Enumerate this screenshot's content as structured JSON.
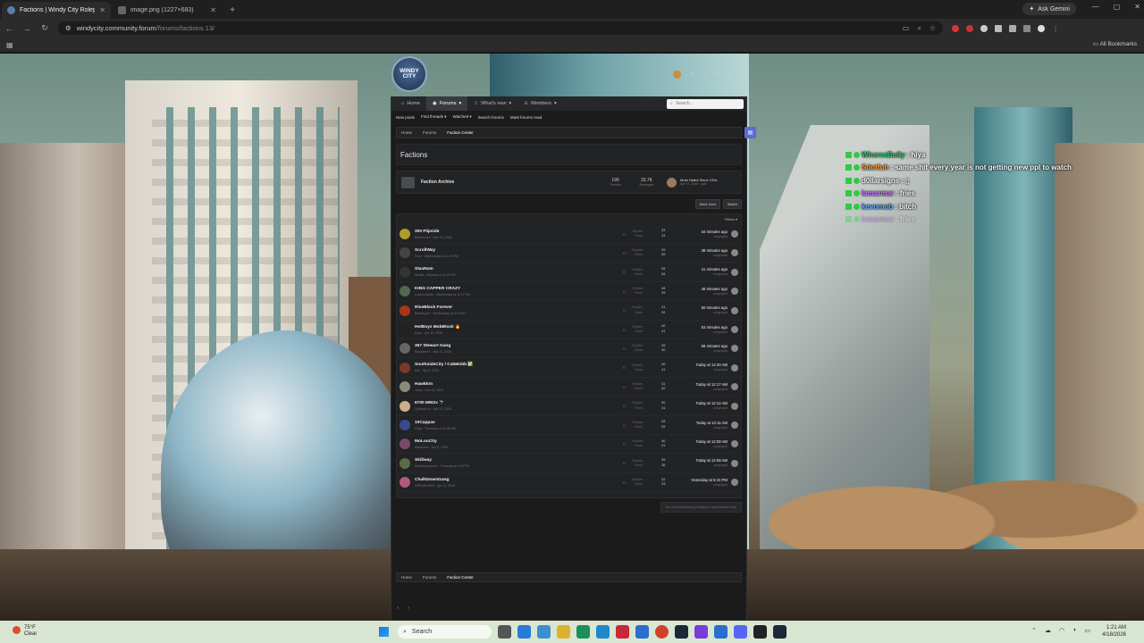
{
  "browser": {
    "tabs": [
      {
        "title": "Factions | Windy City Roleplay",
        "active": true
      },
      {
        "title": "image.png (1227×683)",
        "active": false
      }
    ],
    "new_tab_icon": "plus-icon",
    "ask_gemini": "Ask Gemini",
    "url_host": "windycity.community.forum",
    "url_path": "/forums/factions.13/",
    "all_bookmarks": "All Bookmarks"
  },
  "forum": {
    "logo_text": "WINDY CITY",
    "nav": {
      "home": "Home",
      "forums": "Forums",
      "whats_new": "What's new",
      "members": "Members",
      "search_placeholder": "Search..."
    },
    "subnav": [
      "New posts",
      "Find threads",
      "Watched",
      "Search forums",
      "Mark forums read"
    ],
    "breadcrumbs": [
      "Home",
      "Forums",
      "Faction Center"
    ],
    "page_title": "Factions",
    "archive": {
      "title": "Faction Archive",
      "threads": "199",
      "threads_label": "Threads",
      "messages": "33.7K",
      "messages_label": "Messages",
      "last_title": "Most Hated Since 100s",
      "last_meta": "Apr 17, 2026 · yaki"
    },
    "buttons": {
      "mark_read": "Mark read",
      "watch": "Watch",
      "filters": "Filters"
    },
    "threads": [
      {
        "title": "300 Flipside",
        "meta": "BlueDream · Nov 14, 2025",
        "replies": "33",
        "views": "34",
        "time": "34 minutes ago",
        "user": "unsyruped",
        "color": "#b09a2a"
      },
      {
        "title": "ScrollWay",
        "meta": "Drizz · Wednesday at 11:40 PM",
        "replies": "29",
        "views": "30",
        "time": "38 minutes ago",
        "user": "unsyruped",
        "color": "#444"
      },
      {
        "title": "StaxNom",
        "meta": "Medlin · Monday at 11:13 PM",
        "replies": "28",
        "views": "28",
        "time": "41 minutes ago",
        "user": "unsyruped",
        "color": "#333"
      },
      {
        "title": "KING CAPPER CRAZY",
        "meta": "poleto.cardity · Wednesday at 11:07 PM",
        "replies": "28",
        "views": "29",
        "time": "48 minutes ago",
        "user": "unsyruped",
        "color": "#556655"
      },
      {
        "title": "RiseBlock Forever",
        "meta": "Bleaveyork · Wednesday at 8:19 AM",
        "replies": "31",
        "views": "32",
        "time": "50 minutes ago",
        "user": "unsyruped",
        "color": "#a8361a"
      },
      {
        "title": "HotBoyz MobBlock 🔥",
        "meta": "Ryan · Apr 10, 2026",
        "replies": "40",
        "views": "41",
        "time": "53 minutes ago",
        "user": "unsyruped",
        "color": "#222"
      },
      {
        "title": "357 Stewart Gang",
        "meta": "Blackjerms · Mar 31, 2026",
        "replies": "39",
        "views": "40",
        "time": "58 minutes ago",
        "user": "unsyruped",
        "color": "#666"
      },
      {
        "title": "SouthsideCity / CabMobb ✅",
        "meta": "Bex · Apr 8, 2026",
        "replies": "40",
        "views": "41",
        "time": "Today at 12:20 AM",
        "user": "unsyruped",
        "color": "#7a3a2a"
      },
      {
        "title": "HawkEm",
        "meta": "Jrkay · Dec 11, 2025",
        "replies": "41",
        "views": "42",
        "time": "Today at 12:17 AM",
        "user": "unsyruped",
        "color": "#8a8a7a"
      },
      {
        "title": "6700 MW2x 🔭",
        "meta": "Quitbank.tv · Apr 12, 2026",
        "replies": "40",
        "views": "41",
        "time": "Today at 12:14 AM",
        "user": "unsyruped",
        "color": "#c9b08a"
      },
      {
        "title": "10Cappas",
        "meta": "Flakx · Thursday at 10:38 PM",
        "replies": "28",
        "views": "29",
        "time": "Today at 12:11 AM",
        "user": "unsyruped",
        "color": "#3a4a8a"
      },
      {
        "title": "MoLouCity",
        "meta": "Mavisiaho · Apr 9, 2026",
        "replies": "40",
        "views": "41",
        "time": "Today at 12:08 AM",
        "user": "unsyruped",
        "color": "#7a4a6a"
      },
      {
        "title": "Skillway",
        "meta": "thismeisauncure · Thursday at 9:38 PM",
        "replies": "35",
        "views": "36",
        "time": "Today at 12:08 AM",
        "user": "unsyruped",
        "color": "#5a6a4a"
      },
      {
        "title": "ChalkDownGang",
        "meta": "DREAM-OMG · Apr 11, 2026",
        "replies": "32",
        "views": "33",
        "time": "Yesterday at 5:24 PM",
        "user": "unsyruped",
        "color": "#b05a7a"
      }
    ],
    "reply_label": "Replies",
    "views_label": "Views",
    "no_permission": "You have insufficient privileges to post threads here."
  },
  "chat": [
    {
      "user": "WheresBully",
      "msg": "hiya",
      "color": "#2ecc71",
      "faded": false
    },
    {
      "user": "Sdotfuh",
      "msg": "same shit every year is not getting new ppl to watch",
      "color": "#ff9b2f",
      "faded": false
    },
    {
      "user": "d0llarsigns",
      "msg": "▯",
      "color": "#ffffff",
      "faded": false
    },
    {
      "user": "lamarmar",
      "msg": "fries",
      "color": "#c77dff",
      "faded": false
    },
    {
      "user": "kevomob",
      "msg": "bitch",
      "color": "#5aa9ff",
      "faded": false
    },
    {
      "user": "lamarmar",
      "msg": "fries",
      "color": "#c77dff",
      "faded": true
    }
  ],
  "taskbar": {
    "temp": "75°F",
    "condition": "Clear",
    "search_label": "Search",
    "time": "1:21 AM",
    "date": "4/18/2026"
  }
}
